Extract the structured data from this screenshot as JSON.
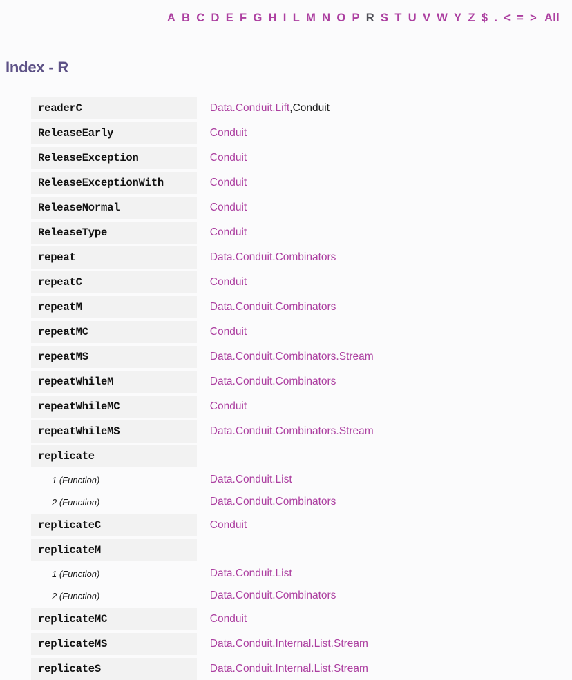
{
  "nav": {
    "items": [
      {
        "label": "A",
        "current": false
      },
      {
        "label": "B",
        "current": false
      },
      {
        "label": "C",
        "current": false
      },
      {
        "label": "D",
        "current": false
      },
      {
        "label": "E",
        "current": false
      },
      {
        "label": "F",
        "current": false
      },
      {
        "label": "G",
        "current": false
      },
      {
        "label": "H",
        "current": false
      },
      {
        "label": "I",
        "current": false
      },
      {
        "label": "L",
        "current": false
      },
      {
        "label": "M",
        "current": false
      },
      {
        "label": "N",
        "current": false
      },
      {
        "label": "O",
        "current": false
      },
      {
        "label": "P",
        "current": false
      },
      {
        "label": "R",
        "current": true
      },
      {
        "label": "S",
        "current": false
      },
      {
        "label": "T",
        "current": false
      },
      {
        "label": "U",
        "current": false
      },
      {
        "label": "V",
        "current": false
      },
      {
        "label": "W",
        "current": false
      },
      {
        "label": "Y",
        "current": false
      },
      {
        "label": "Z",
        "current": false
      },
      {
        "label": "$",
        "current": false
      },
      {
        "label": ".",
        "current": false
      },
      {
        "label": "<",
        "current": false
      },
      {
        "label": "=",
        "current": false
      },
      {
        "label": ">",
        "current": false
      },
      {
        "label": "All",
        "current": false
      }
    ]
  },
  "heading": "Index - R",
  "colors": {
    "link": "#ac3fa0",
    "heading": "#5d5186",
    "current_nav": "#4d4d55",
    "row_bg": "#f2f2f2",
    "page_bg": "#fbfbfc",
    "text": "#1b1b1b"
  },
  "entries": [
    {
      "name": "readerC",
      "sub": false,
      "modules": [
        {
          "text": "Data.Conduit.Lift",
          "link": true
        },
        {
          "text": ", ",
          "link": false
        },
        {
          "text": "Conduit",
          "link": false
        }
      ]
    },
    {
      "name": "ReleaseEarly",
      "sub": false,
      "modules": [
        {
          "text": "Conduit",
          "link": true
        }
      ]
    },
    {
      "name": "ReleaseException",
      "sub": false,
      "modules": [
        {
          "text": "Conduit",
          "link": true
        }
      ]
    },
    {
      "name": "ReleaseExceptionWith",
      "sub": false,
      "modules": [
        {
          "text": "Conduit",
          "link": true
        }
      ]
    },
    {
      "name": "ReleaseNormal",
      "sub": false,
      "modules": [
        {
          "text": "Conduit",
          "link": true
        }
      ]
    },
    {
      "name": "ReleaseType",
      "sub": false,
      "modules": [
        {
          "text": "Conduit",
          "link": true
        }
      ]
    },
    {
      "name": "repeat",
      "sub": false,
      "modules": [
        {
          "text": "Data.Conduit.Combinators",
          "link": true
        }
      ]
    },
    {
      "name": "repeatC",
      "sub": false,
      "modules": [
        {
          "text": "Conduit",
          "link": true
        }
      ]
    },
    {
      "name": "repeatM",
      "sub": false,
      "modules": [
        {
          "text": "Data.Conduit.Combinators",
          "link": true
        }
      ]
    },
    {
      "name": "repeatMC",
      "sub": false,
      "modules": [
        {
          "text": "Conduit",
          "link": true
        }
      ]
    },
    {
      "name": "repeatMS",
      "sub": false,
      "modules": [
        {
          "text": "Data.Conduit.Combinators.Stream",
          "link": true
        }
      ]
    },
    {
      "name": "repeatWhileM",
      "sub": false,
      "modules": [
        {
          "text": "Data.Conduit.Combinators",
          "link": true
        }
      ]
    },
    {
      "name": "repeatWhileMC",
      "sub": false,
      "modules": [
        {
          "text": "Conduit",
          "link": true
        }
      ]
    },
    {
      "name": "repeatWhileMS",
      "sub": false,
      "modules": [
        {
          "text": "Data.Conduit.Combinators.Stream",
          "link": true
        }
      ]
    },
    {
      "name": "replicate",
      "sub": false,
      "modules": []
    },
    {
      "name": "1 (Function)",
      "sub": true,
      "modules": [
        {
          "text": "Data.Conduit.List",
          "link": true
        }
      ]
    },
    {
      "name": "2 (Function)",
      "sub": true,
      "modules": [
        {
          "text": "Data.Conduit.Combinators",
          "link": true
        }
      ]
    },
    {
      "name": "replicateC",
      "sub": false,
      "modules": [
        {
          "text": "Conduit",
          "link": true
        }
      ]
    },
    {
      "name": "replicateM",
      "sub": false,
      "modules": []
    },
    {
      "name": "1 (Function)",
      "sub": true,
      "modules": [
        {
          "text": "Data.Conduit.List",
          "link": true
        }
      ]
    },
    {
      "name": "2 (Function)",
      "sub": true,
      "modules": [
        {
          "text": "Data.Conduit.Combinators",
          "link": true
        }
      ]
    },
    {
      "name": "replicateMC",
      "sub": false,
      "modules": [
        {
          "text": "Conduit",
          "link": true
        }
      ]
    },
    {
      "name": "replicateMS",
      "sub": false,
      "modules": [
        {
          "text": "Data.Conduit.Internal.List.Stream",
          "link": true
        }
      ]
    },
    {
      "name": "replicateS",
      "sub": false,
      "modules": [
        {
          "text": "Data.Conduit.Internal.List.Stream",
          "link": true
        }
      ]
    }
  ]
}
